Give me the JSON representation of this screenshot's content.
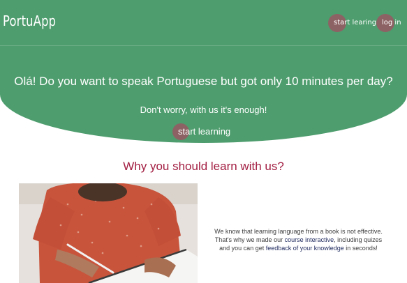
{
  "app": {
    "logo": "PortuApp"
  },
  "nav": {
    "start_label": "start learing",
    "login_label": "log in"
  },
  "hero": {
    "headline": "Olá! Do you want to speak Portuguese but got only 10 minutes per day?",
    "subline": "Don't worry, with us it's enough!",
    "cta_label": "start learning"
  },
  "why": {
    "title": "Why you should learn with us?"
  },
  "feature": {
    "text_1": "We know that learning language from a book is not effective. That's why we made our ",
    "highlight_1": "course interactive",
    "text_2": ", including quizes and you can get ",
    "highlight_2": "feedback of your knowledge",
    "text_3": " in seconds!"
  },
  "colors": {
    "hero_green": "#4e9d6e",
    "button_circle": "#8d6264",
    "title_red": "#a21d41",
    "highlight_navy": "#1f2a5e"
  }
}
